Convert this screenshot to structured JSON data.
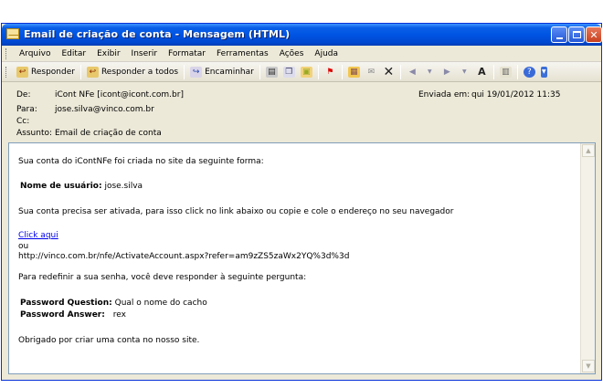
{
  "window": {
    "title": "Email de criação de conta - Mensagem (HTML)"
  },
  "menu": {
    "items": [
      "Arquivo",
      "Editar",
      "Exibir",
      "Inserir",
      "Formatar",
      "Ferramentas",
      "Ações",
      "Ajuda"
    ]
  },
  "toolbar": {
    "reply_label": "Responder",
    "reply_all_label": "Responder a todos",
    "forward_label": "Encaminhar",
    "font_icon_label": "A"
  },
  "header": {
    "from_label": "De:",
    "from_value": "iCont NFe [icont@icont.com.br]",
    "to_label": "Para:",
    "to_value": "jose.silva@vinco.com.br",
    "cc_label": "Cc:",
    "cc_value": "",
    "subject_label": "Assunto:",
    "subject_value": "Email de criação de conta",
    "sent_label": "Enviada em:",
    "sent_value": "qui 19/01/2012 11:35"
  },
  "body": {
    "intro": "Sua conta do iContNFe foi criada no site da seguinte forma:",
    "username_label": "Nome de usuário:",
    "username_value": "jose.silva",
    "activation_text": "Sua conta precisa ser ativada, para isso click no link abaixo ou copie e cole o endereço no seu navegador",
    "link_text": "Click aqui",
    "or_text": "ou",
    "url": "http://vinco.com.br/nfe/ActivateAccount.aspx?refer=am9zZS5zaWx2YQ%3d%3d",
    "reset_text": "Para redefinir a sua senha, você deve responder à seguinte pergunta:",
    "question_label": "Password Question:",
    "question_value": "Qual o nome do cacho",
    "answer_label": "Password Answer:",
    "answer_value": "rex",
    "thanks": "Obrigado por criar uma conta no nosso site."
  }
}
